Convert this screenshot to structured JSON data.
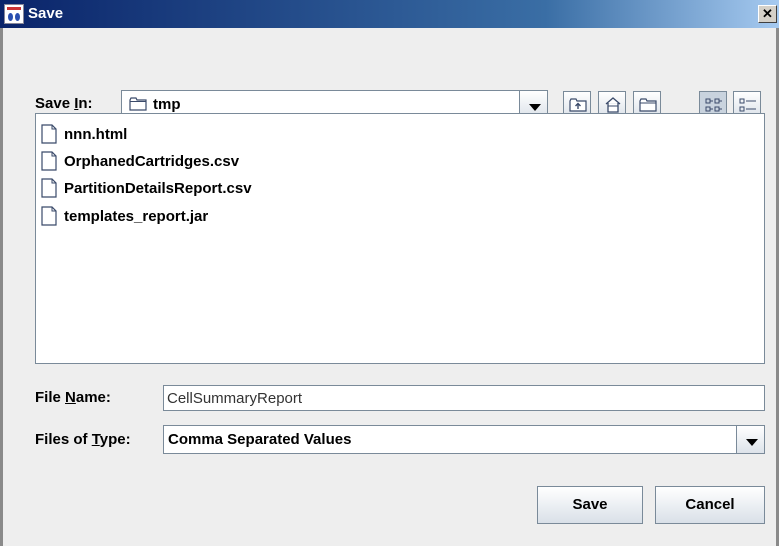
{
  "window": {
    "title": "Save",
    "close_glyph": "✕"
  },
  "save_in": {
    "label_pre": "Save ",
    "label_mnemonic": "I",
    "label_post": "n:",
    "folder": "tmp"
  },
  "toolbar": {
    "buttons": [
      "up-one-level-icon",
      "home-icon",
      "new-folder-icon",
      "list-view-icon",
      "details-view-icon"
    ]
  },
  "files": [
    {
      "name": "nnn.html"
    },
    {
      "name": "OrphanedCartridges.csv"
    },
    {
      "name": "PartitionDetailsReport.csv"
    },
    {
      "name": "templates_report.jar"
    }
  ],
  "file_name": {
    "label_pre": "File ",
    "label_mnemonic": "N",
    "label_post": "ame:",
    "value": "CellSummaryReport"
  },
  "file_type": {
    "label_pre": "Files of ",
    "label_mnemonic": "T",
    "label_post": "ype:",
    "selected": "Comma Separated Values"
  },
  "actions": {
    "save_label": "Save",
    "cancel_label": "Cancel"
  },
  "colors": {
    "title_bar_start": "#0a246a",
    "title_bar_end": "#a6caf0",
    "dialog_background": "#eeeeee"
  }
}
